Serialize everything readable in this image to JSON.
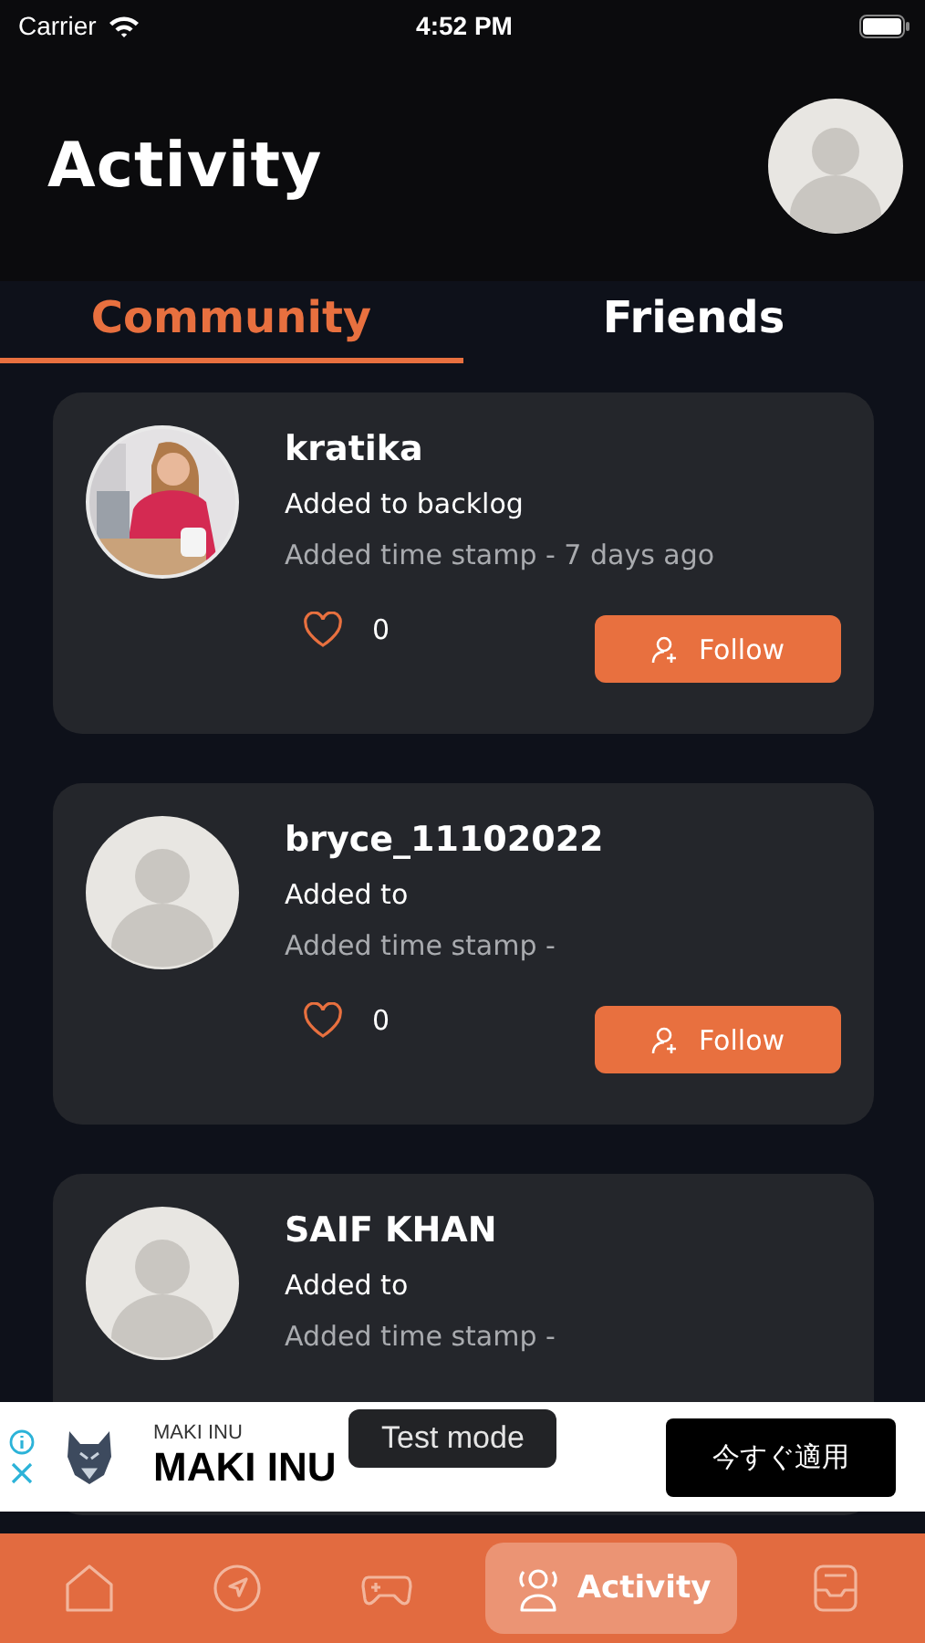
{
  "status_bar": {
    "carrier": "Carrier",
    "time": "4:52 PM"
  },
  "header": {
    "title": "Activity"
  },
  "tabs": [
    {
      "label": "Community",
      "selected": true
    },
    {
      "label": "Friends",
      "selected": false
    }
  ],
  "cards": [
    {
      "username": "kratika",
      "action": "Added  to backlog",
      "timestamp": "Added time stamp -  7 days ago",
      "likes": "0",
      "follow": "Follow"
    },
    {
      "kind": "placeholder",
      "username": "bryce_11102022",
      "action": "Added  to",
      "timestamp": "Added time stamp -",
      "likes": "0",
      "follow": "Follow"
    },
    {
      "kind": "placeholder",
      "username": "SAIF KHAN",
      "action": "Added  to",
      "timestamp": "Added time stamp -"
    }
  ],
  "ad": {
    "advertiser": "MAKI INU",
    "headline": "MAKI INU",
    "cta": "今すぐ適用",
    "toast": "Test mode"
  },
  "nav": [
    {
      "selected": false
    },
    {
      "selected": false
    },
    {
      "selected": false
    },
    {
      "label": "Activity",
      "selected": true
    },
    {
      "selected": false
    }
  ]
}
